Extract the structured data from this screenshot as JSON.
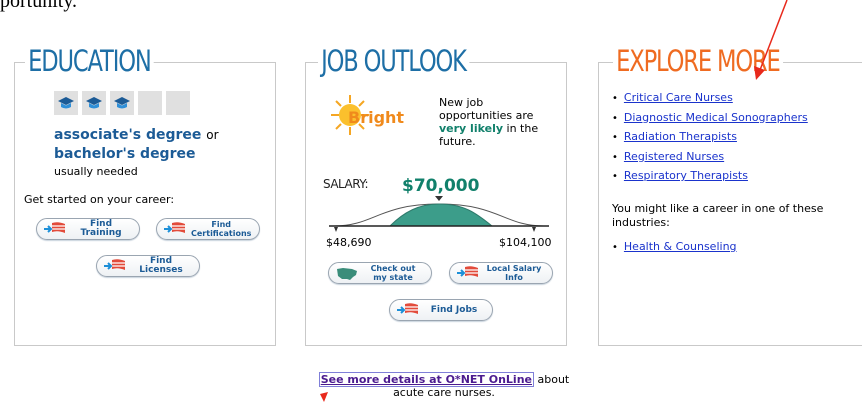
{
  "top_fragment": "portunity.",
  "education": {
    "title": "EDUCATION",
    "degree1": "associate's degree",
    "or_text": "or",
    "degree2": "bachelor's degree",
    "usually": "usually needed",
    "get_started": "Get started on your career:",
    "find_training": "Find Training",
    "find_certifications": "Find Certifications",
    "find_licenses": "Find Licenses"
  },
  "job_outlook": {
    "title": "JOB OUTLOOK",
    "outlook_word": "Bright",
    "line1": "New job opportunities are",
    "very_likely": "very likely",
    "line2": "in the future.",
    "salary_label": "SALARY:",
    "salary_value": "$70,000",
    "salary_low": "$48,690",
    "salary_high": "$104,100",
    "check_state": "Check out my state",
    "local_salary": "Local Salary Info",
    "find_jobs": "Find Jobs"
  },
  "explore_more": {
    "title": "EXPLORE MORE",
    "careers": [
      "Critical Care Nurses",
      "Diagnostic Medical Sonographers",
      "Radiation Therapists",
      "Registered Nurses",
      "Respiratory Therapists"
    ],
    "industries_text": "You might like a career in one of these industries:",
    "industries": [
      "Health & Counseling"
    ]
  },
  "footer": {
    "link": "See more details at O*NET OnLine",
    "about": "about",
    "line2": "acute care nurses."
  }
}
